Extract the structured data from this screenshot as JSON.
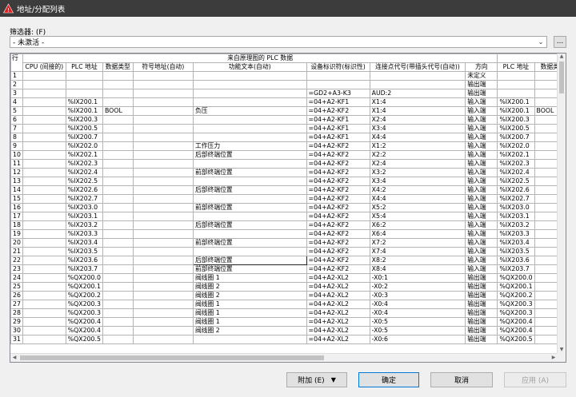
{
  "window": {
    "title": "地址/分配列表",
    "icon": "warning-triangle-icon"
  },
  "filter": {
    "label": "筛选器: (F)",
    "value": "- 未激活 -",
    "more_label": "..."
  },
  "grid": {
    "corner_label": "行",
    "group_header": "来自原理图的 PLC 数据",
    "columns": [
      "CPU (间接的)",
      "PLC 地址",
      "数据类型",
      "符号地址(自动)",
      "功能文本(自动)",
      "设备标识符(标识性)",
      "连接点代号(带插头代号(自动))",
      "方向",
      "PLC 地址",
      "数据类"
    ],
    "rows": [
      [
        "1",
        "",
        "",
        "",
        "",
        "",
        "",
        "",
        "未定义",
        "",
        ""
      ],
      [
        "2",
        "",
        "",
        "",
        "",
        "",
        "",
        "",
        "输出端",
        "",
        ""
      ],
      [
        "3",
        "",
        "",
        "",
        "",
        "",
        "=GD2+A3-K3",
        "AUD:2",
        "输出端",
        "",
        ""
      ],
      [
        "4",
        "",
        "%IX200.1",
        "",
        "",
        "",
        "=04+A2-KF1",
        "X1:4",
        "输入端",
        "%IX200.1",
        ""
      ],
      [
        "5",
        "",
        "%IX200.1",
        "BOOL",
        "",
        "负压",
        "=04+A2-KF2",
        "X1:4",
        "输入端",
        "%IX200.1",
        "BOOL"
      ],
      [
        "6",
        "",
        "%IX200.3",
        "",
        "",
        "",
        "=04+A2-KF1",
        "X2:4",
        "输入端",
        "%IX200.3",
        ""
      ],
      [
        "7",
        "",
        "%IX200.5",
        "",
        "",
        "",
        "=04+A2-KF1",
        "X3:4",
        "输入端",
        "%IX200.5",
        ""
      ],
      [
        "8",
        "",
        "%IX200.7",
        "",
        "",
        "",
        "=04+A2-KF1",
        "X4:4",
        "输入端",
        "%IX200.7",
        ""
      ],
      [
        "9",
        "",
        "%IX202.0",
        "",
        "",
        "工作压力",
        "=04+A2-KF2",
        "X1:2",
        "输入端",
        "%IX202.0",
        ""
      ],
      [
        "10",
        "",
        "%IX202.1",
        "",
        "",
        "后部终端位置",
        "=04+A2-KF2",
        "X2:2",
        "输入端",
        "%IX202.1",
        ""
      ],
      [
        "11",
        "",
        "%IX202.3",
        "",
        "",
        "",
        "=04+A2-KF2",
        "X2:4",
        "输入端",
        "%IX202.3",
        ""
      ],
      [
        "12",
        "",
        "%IX202.4",
        "",
        "",
        "前部终端位置",
        "=04+A2-KF2",
        "X3:2",
        "输入端",
        "%IX202.4",
        ""
      ],
      [
        "13",
        "",
        "%IX202.5",
        "",
        "",
        "",
        "=04+A2-KF2",
        "X3:4",
        "输入端",
        "%IX202.5",
        ""
      ],
      [
        "14",
        "",
        "%IX202.6",
        "",
        "",
        "后部终端位置",
        "=04+A2-KF2",
        "X4:2",
        "输入端",
        "%IX202.6",
        ""
      ],
      [
        "15",
        "",
        "%IX202.7",
        "",
        "",
        "",
        "=04+A2-KF2",
        "X4:4",
        "输入端",
        "%IX202.7",
        ""
      ],
      [
        "16",
        "",
        "%IX203.0",
        "",
        "",
        "前部终端位置",
        "=04+A2-KF2",
        "X5:2",
        "输入端",
        "%IX203.0",
        ""
      ],
      [
        "17",
        "",
        "%IX203.1",
        "",
        "",
        "",
        "=04+A2-KF2",
        "X5:4",
        "输入端",
        "%IX203.1",
        ""
      ],
      [
        "18",
        "",
        "%IX203.2",
        "",
        "",
        "后部终端位置",
        "=04+A2-KF2",
        "X6:2",
        "输入端",
        "%IX203.2",
        ""
      ],
      [
        "19",
        "",
        "%IX203.3",
        "",
        "",
        "",
        "=04+A2-KF2",
        "X6:4",
        "输入端",
        "%IX203.3",
        ""
      ],
      [
        "20",
        "",
        "%IX203.4",
        "",
        "",
        "前部终端位置",
        "=04+A2-KF2",
        "X7:2",
        "输入端",
        "%IX203.4",
        ""
      ],
      [
        "21",
        "",
        "%IX203.5",
        "",
        "",
        "",
        "=04+A2-KF2",
        "X7:4",
        "输入端",
        "%IX203.5",
        ""
      ],
      [
        "22",
        "",
        "%IX203.6",
        "",
        "",
        "后部终端位置",
        "=04+A2-KF2",
        "X8:2",
        "输入端",
        "%IX203.6",
        ""
      ],
      [
        "23",
        "",
        "%IX203.7",
        "",
        "",
        "前部终端位置",
        "=04+A2-KF2",
        "X8:4",
        "输入端",
        "%IX203.7",
        ""
      ],
      [
        "24",
        "",
        "%QX200.0",
        "",
        "",
        "阀线圈 1",
        "=04+A2-XL2",
        "-X0:1",
        "输出端",
        "%QX200.0",
        ""
      ],
      [
        "25",
        "",
        "%QX200.1",
        "",
        "",
        "阀线圈 2",
        "=04+A2-XL2",
        "-X0:2",
        "输出端",
        "%QX200.1",
        ""
      ],
      [
        "26",
        "",
        "%QX200.2",
        "",
        "",
        "阀线圈 2",
        "=04+A2-XL2",
        "-X0:3",
        "输出端",
        "%QX200.2",
        ""
      ],
      [
        "27",
        "",
        "%QX200.3",
        "",
        "",
        "阀线圈 1",
        "=04+A2-XL2",
        "-X0:4",
        "输出端",
        "%QX200.3",
        ""
      ],
      [
        "28",
        "",
        "%QX200.3",
        "",
        "",
        "阀线圈 1",
        "=04+A2-XL2",
        "-X0:4",
        "输出端",
        "%QX200.3",
        ""
      ],
      [
        "29",
        "",
        "%QX200.4",
        "",
        "",
        "阀线圈 1",
        "=04+A2-XL2",
        "-X0:5",
        "输出端",
        "%QX200.4",
        ""
      ],
      [
        "30",
        "",
        "%QX200.4",
        "",
        "",
        "阀线圈 2",
        "=04+A2-XL2",
        "-X0:5",
        "输出端",
        "%QX200.4",
        ""
      ],
      [
        "31",
        "",
        "%QX200.5",
        "",
        "",
        "",
        "=04+A2-XL2",
        "-X0:6",
        "输出端",
        "%QX200.5",
        ""
      ]
    ],
    "selected_row": 22,
    "selected_col": 5
  },
  "buttons": {
    "attach": "附加 (E)",
    "ok": "确定",
    "cancel": "取消",
    "apply": "应用 (A)"
  }
}
